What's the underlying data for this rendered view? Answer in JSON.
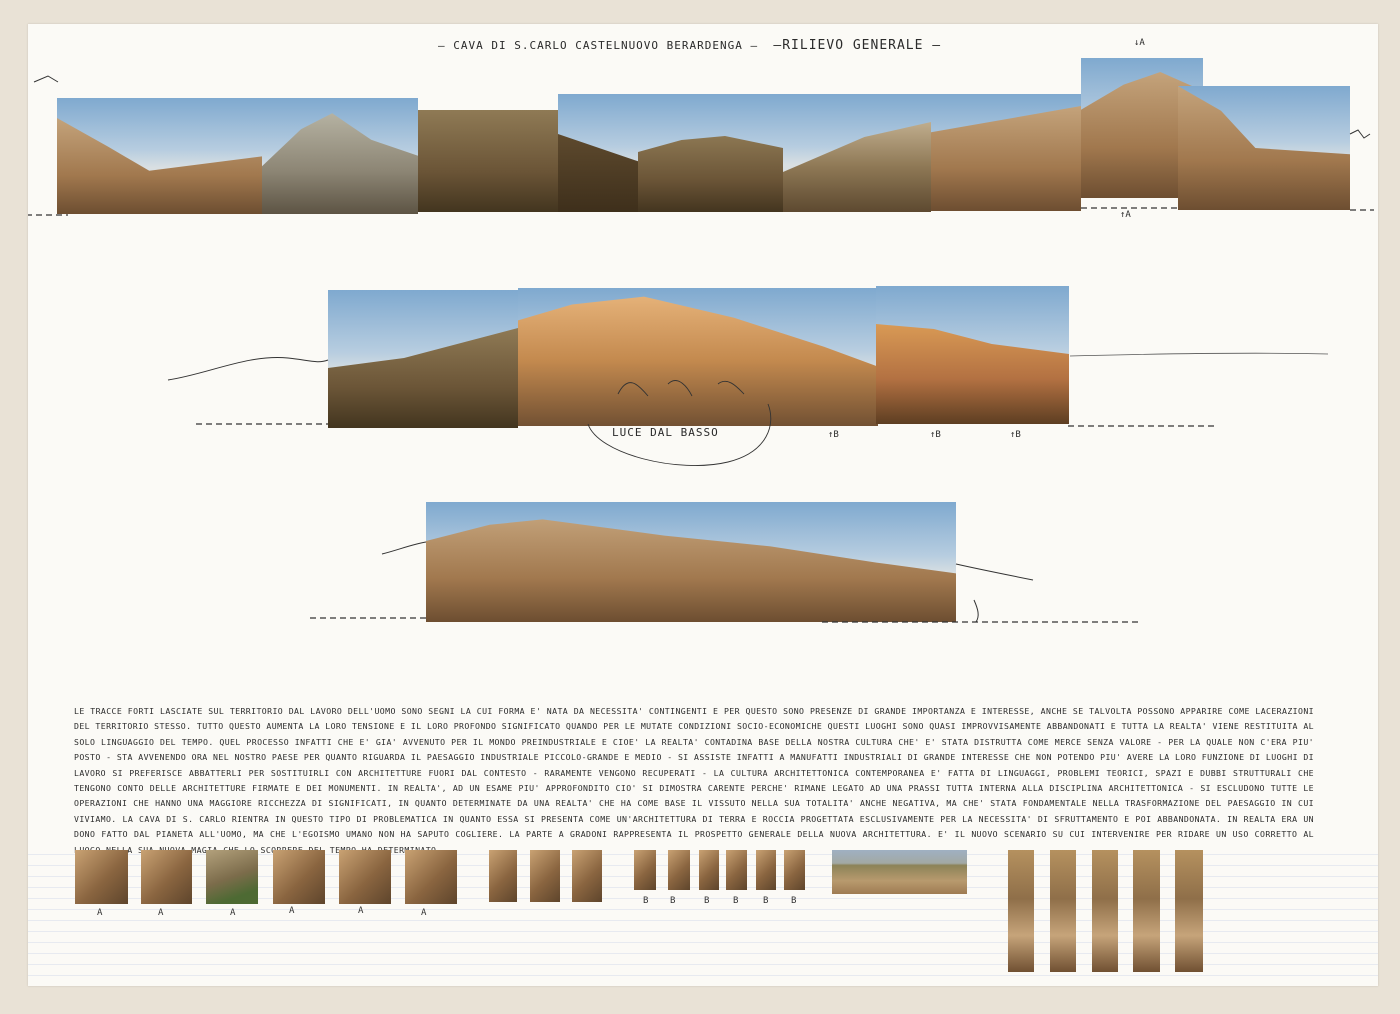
{
  "sheet": {
    "title": "– CAVA DI S.CARLO CASTELNUOVO BERARDENGA –",
    "subtitle": "–RILIEVO GENERALE –",
    "section_marker_top": "↓A",
    "section_marker_bottom": "↑A"
  },
  "panorama_2": {
    "caption": "LUCE DAL BASSO",
    "markers": [
      "↑B",
      "↑B",
      "↑B"
    ]
  },
  "essay": {
    "text": "LE TRACCE FORTI LASCIATE SUL TERRITORIO DAL LAVORO DELL'UOMO SONO SEGNI LA CUI FORMA E' NATA DA NECESSITA' CONTINGENTI E PER QUESTO SONO PRESENZE DI GRANDE IMPORTANZA E INTERESSE, ANCHE SE TALVOLTA POSSONO APPARIRE COME LACERAZIONI DEL TERRITORIO STESSO. TUTTO QUESTO AUMENTA LA LORO TENSIONE E IL LORO PROFONDO SIGNIFICATO QUANDO PER LE MUTATE CONDIZIONI SOCIO-ECONOMICHE QUESTI LUOGHI SONO QUASI IMPROVVISAMENTE ABBANDONATI E TUTTA LA REALTA' VIENE RESTITUITA AL SOLO LINGUAGGIO DEL TEMPO. QUEL PROCESSO INFATTI CHE E' GIA' AVVENUTO PER IL MONDO PREINDUSTRIALE E CIOE' LA REALTA' CONTADINA BASE DELLA NOSTRA CULTURA CHE' E' STATA DISTRUTTA COME MERCE SENZA VALORE - PER LA QUALE NON C'ERA PIU' POSTO - STA AVVENENDO ORA NEL NOSTRO PAESE PER QUANTO RIGUARDA IL PAESAGGIO INDUSTRIALE PICCOLO-GRANDE E MEDIO - SI ASSISTE INFATTI A MANUFATTI INDUSTRIALI DI GRANDE INTERESSE CHE NON POTENDO PIU' AVERE LA LORO FUNZIONE DI LUOGHI DI LAVORO SI PREFERISCE ABBATTERLI PER SOSTITUIRLI CON ARCHITETTURE FUORI DAL CONTESTO - RARAMENTE VENGONO RECUPERATI - LA CULTURA ARCHITETTONICA CONTEMPORANEA E' FATTA DI LINGUAGGI, PROBLEMI TEORICI, SPAZI E DUBBI STRUTTURALI CHE TENGONO CONTO DELLE ARCHITETTURE FIRMATE E DEI MONUMENTI. IN REALTA', AD UN ESAME PIU' APPROFONDITO CIO' SI DIMOSTRA CARENTE PERCHE' RIMANE LEGATO AD UNA PRASSI TUTTA INTERNA ALLA DISCIPLINA ARCHITETTONICA - SI ESCLUDONO TUTTE LE OPERAZIONI CHE HANNO UNA MAGGIORE RICCHEZZA DI SIGNIFICATI, IN QUANTO DETERMINATE DA UNA REALTA' CHE HA COME BASE IL VISSUTO NELLA SUA TOTALITA' ANCHE NEGATIVA, MA CHE' STATA FONDAMENTALE NELLA TRASFORMAZIONE DEL PAESAGGIO IN CUI VIVIAMO. LA CAVA DI S. CARLO RIENTRA IN QUESTO TIPO DI PROBLEMATICA IN QUANTO ESSA SI PRESENTA COME UN'ARCHITETTURA DI TERRA E ROCCIA PROGETTATA ESCLUSIVAMENTE PER LA NECESSITA' DI SFRUTTAMENTO E POI ABBANDONATA. IN REALTA ERA UN DONO FATTO DAL PIANETA ALL'UOMO, MA CHE L'EGOISMO UMANO NON HA SAPUTO COGLIERE. LA PARTE A GRADONI RAPPRESENTA IL PROSPETTO GENERALE DELLA NUOVA ARCHITETTURA. E' IL NUOVO SCENARIO SU CUI INTERVENIRE PER RIDARE UN USO CORRETTO AL LUOGO NELLA SUA NUOVA MAGIA CHE LO SCORRERE DEL TEMPO HA DETERMINATO."
  },
  "detail_labels_a": [
    "A",
    "A",
    "A",
    "A",
    "A",
    "A"
  ],
  "detail_labels_b": [
    "B",
    "B",
    "B",
    "B",
    "B",
    "B"
  ]
}
